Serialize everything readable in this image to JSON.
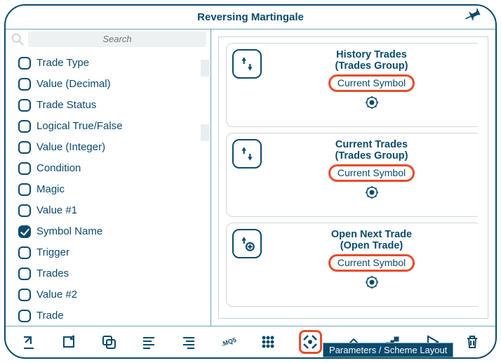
{
  "window": {
    "title": "Reversing Martingale"
  },
  "search": {
    "placeholder": "Search"
  },
  "filters": [
    {
      "label": "Trade Type",
      "checked": false
    },
    {
      "label": "Value (Decimal)",
      "checked": false
    },
    {
      "label": "Trade Status",
      "checked": false
    },
    {
      "label": "Logical True/False",
      "checked": false
    },
    {
      "label": "Value (Integer)",
      "checked": false
    },
    {
      "label": "Condition",
      "checked": false
    },
    {
      "label": "Magic",
      "checked": false
    },
    {
      "label": "Value #1",
      "checked": false
    },
    {
      "label": "Symbol Name",
      "checked": true
    },
    {
      "label": "Trigger",
      "checked": false
    },
    {
      "label": "Trades",
      "checked": false
    },
    {
      "label": "Value #2",
      "checked": false
    },
    {
      "label": "Trade",
      "checked": false
    }
  ],
  "nodes": [
    {
      "icon": "arrows",
      "title": "History Trades",
      "subtitle": "(Trades Group)",
      "pill": "Current Symbol"
    },
    {
      "icon": "arrows",
      "title": "Current Trades",
      "subtitle": "(Trades Group)",
      "pill": "Current Symbol"
    },
    {
      "icon": "arrows-plus",
      "title": "Open Next Trade",
      "subtitle": "(Open Trade)",
      "pill": "Current Symbol"
    }
  ],
  "toolbar": {
    "items": [
      {
        "id": "import",
        "name": "import-icon"
      },
      {
        "id": "export",
        "name": "export-icon"
      },
      {
        "id": "copy",
        "name": "copy-overlap-icon"
      },
      {
        "id": "align-left",
        "name": "align-left-icon"
      },
      {
        "id": "align-right",
        "name": "align-right-icon"
      },
      {
        "id": "mq5",
        "name": "mq5-icon"
      },
      {
        "id": "grid",
        "name": "grid-icon"
      },
      {
        "id": "layout",
        "name": "layout-icon",
        "highlight": true
      },
      {
        "id": "eraser",
        "name": "eraser-icon"
      },
      {
        "id": "blocks",
        "name": "blocks-icon"
      },
      {
        "id": "play",
        "name": "play-icon"
      },
      {
        "id": "trash",
        "name": "trash-icon"
      }
    ],
    "tooltip": "Parameters / Scheme Layout"
  }
}
